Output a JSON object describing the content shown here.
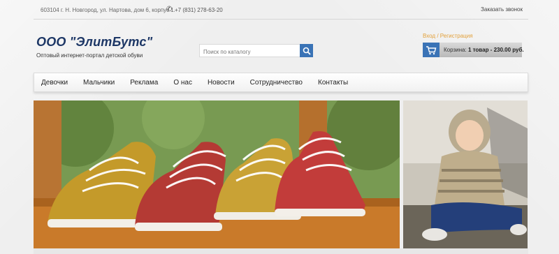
{
  "topbar": {
    "address": "603104 г. Н. Новгород, ул. Нартова, дом 6, корпус 1.",
    "phone": "+7 (831) 278-63-20",
    "callback": "Заказать звонок"
  },
  "brand": {
    "name": "ООО \"ЭлитБутс\"",
    "tagline": "Оптовый интернет-портал детской обуви"
  },
  "search": {
    "placeholder": "Поиск по каталогу"
  },
  "account": {
    "login": "Вход",
    "separator": " / ",
    "register": "Регистрация"
  },
  "cart": {
    "label": "Корзина:",
    "summary": "1 товар - 230.00 руб."
  },
  "nav": {
    "items": [
      {
        "label": "Девочки"
      },
      {
        "label": "Мальчики"
      },
      {
        "label": "Реклама"
      },
      {
        "label": "О нас"
      },
      {
        "label": "Новости"
      },
      {
        "label": "Сотрудничество"
      },
      {
        "label": "Контакты"
      }
    ]
  },
  "icons": {
    "search": "search-icon",
    "cart": "cart-icon",
    "phone": "phone-icon"
  },
  "colors": {
    "accent": "#3a73b6",
    "brand": "#1d3766",
    "login": "#e2a03a"
  }
}
